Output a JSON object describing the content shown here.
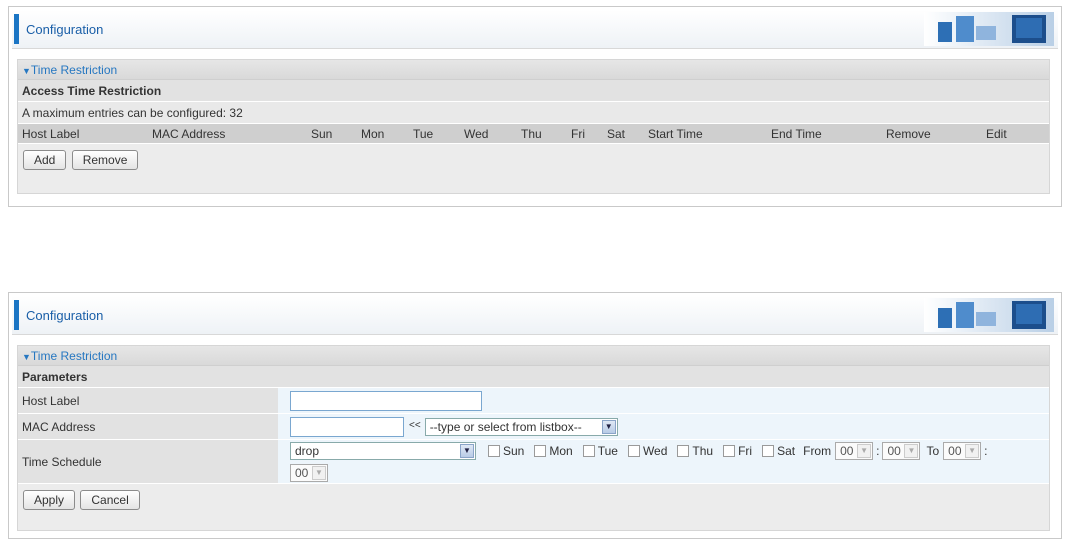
{
  "panel1": {
    "header_title": "Configuration",
    "section_title": "Time Restriction",
    "subsection_title": "Access Time Restriction",
    "info_text": "A maximum entries can be configured: 32",
    "columns": [
      "Host Label",
      "MAC Address",
      "Sun",
      "Mon",
      "Tue",
      "Wed",
      "Thu",
      "Fri",
      "Sat",
      "Start Time",
      "End Time",
      "Remove",
      "Edit"
    ],
    "add_label": "Add",
    "remove_label": "Remove"
  },
  "panel2": {
    "header_title": "Configuration",
    "section_title": "Time Restriction",
    "subsection_title": "Parameters",
    "host_label": {
      "label": "Host Label",
      "value": ""
    },
    "mac_address": {
      "label": "MAC Address",
      "value": "",
      "arrow_text": "<<",
      "listbox_value": "--type or select from listbox--"
    },
    "time_schedule": {
      "label": "Time Schedule",
      "action_value": "drop",
      "days": [
        "Sun",
        "Mon",
        "Tue",
        "Wed",
        "Thu",
        "Fri",
        "Sat"
      ],
      "from_label": "From",
      "from_hour": "00",
      "colon1": ":",
      "from_min": "00",
      "to_label": "To",
      "to_hour": "00",
      "colon2": ":",
      "to_min": "00"
    },
    "apply_label": "Apply",
    "cancel_label": "Cancel"
  },
  "colors": {
    "accent": "#1b75c4",
    "section_title_text": "#2677c1",
    "field_bg": "#edf5fb"
  },
  "icons": {
    "banner": "network-devices-banner",
    "section_toggle": "triangle-down-icon",
    "select_arrow": "chevron-down-icon"
  }
}
